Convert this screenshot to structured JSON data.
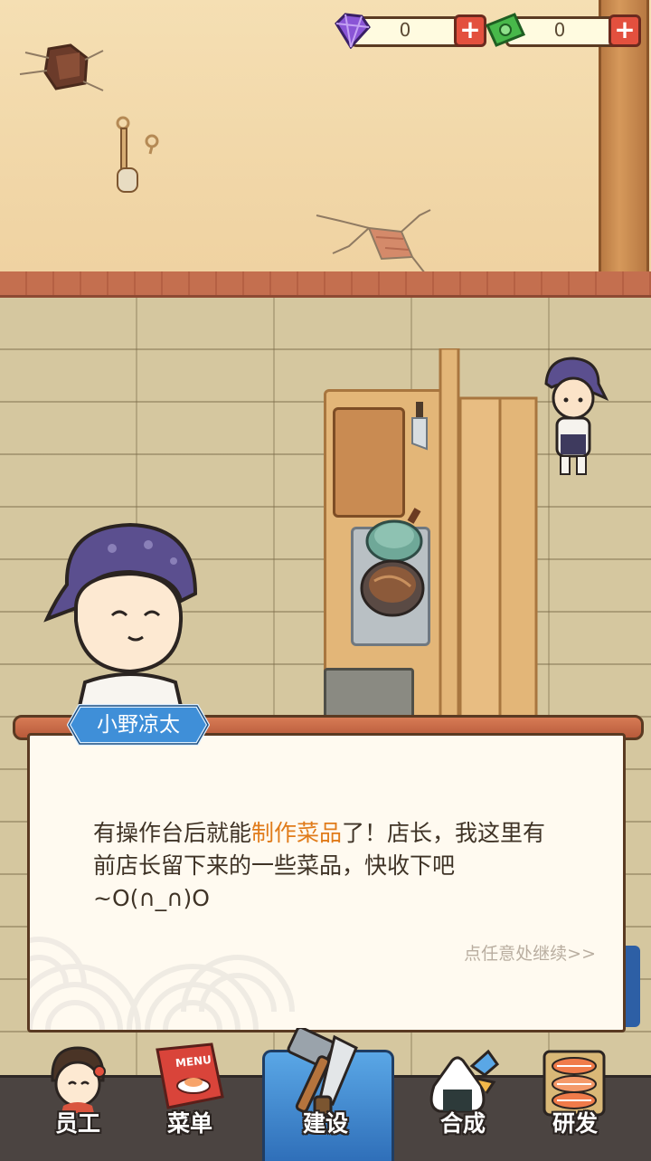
{
  "currency": {
    "gems": {
      "value": "0",
      "icon": "purple-gem-icon",
      "plus": "+"
    },
    "cash": {
      "value": "0",
      "icon": "cash-icon",
      "plus": "+"
    }
  },
  "dialog": {
    "speaker": "小野凉太",
    "text_before": "有操作台后就能",
    "text_highlight": "制作菜品",
    "text_after": "了！店长，我这里有前店长留下来的一些菜品，快收下吧~O(∩_∩)O",
    "continue_hint": "点任意处继续>>"
  },
  "nav": {
    "items": [
      {
        "label": "员工",
        "icon": "staff-avatar-icon"
      },
      {
        "label": "菜单",
        "icon": "menu-book-icon",
        "icon_text": "MENU"
      },
      {
        "label": "建设",
        "icon": "hammer-saw-icon",
        "active": true
      },
      {
        "label": "合成",
        "icon": "onigiri-merge-icon"
      },
      {
        "label": "研发",
        "icon": "sushi-tray-icon"
      }
    ]
  },
  "colors": {
    "highlight": "#e07b1a",
    "nav_active": "#3f88d0",
    "wall": "#f2d9a9",
    "floor": "#d5c79f"
  }
}
